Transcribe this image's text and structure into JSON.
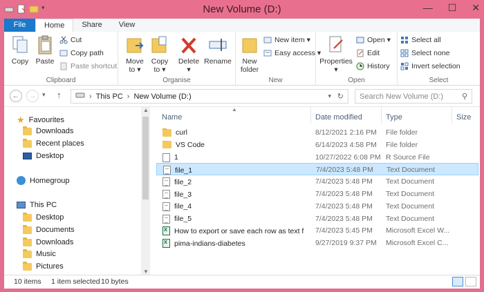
{
  "window": {
    "title": "New Volume (D:)",
    "minimize": "—",
    "maximize": "☐",
    "close": "✕"
  },
  "tabs": [
    {
      "label": "File"
    },
    {
      "label": "Home"
    },
    {
      "label": "Share"
    },
    {
      "label": "View"
    }
  ],
  "ribbon": {
    "clipboard": {
      "label": "Clipboard",
      "copy": "Copy",
      "paste": "Paste",
      "cut": "Cut",
      "copy_path": "Copy path",
      "paste_shortcut": "Paste shortcut"
    },
    "organise": {
      "label": "Organise",
      "move_to": "Move",
      "move_to2": "to ▾",
      "copy_to": "Copy",
      "copy_to2": "to ▾",
      "delete": "Delete",
      "delete2": "▾",
      "rename": "Rename"
    },
    "new": {
      "label": "New",
      "new_folder": "New",
      "new_folder2": "folder",
      "new_item": "New item ▾",
      "easy_access": "Easy access ▾"
    },
    "open": {
      "label": "Open",
      "properties": "Properties",
      "properties2": "▾",
      "open": "Open ▾",
      "edit": "Edit",
      "history": "History"
    },
    "select": {
      "label": "Select",
      "select_all": "Select all",
      "select_none": "Select none",
      "invert": "Invert selection"
    }
  },
  "address": {
    "path": [
      "This PC",
      "New Volume (D:)"
    ],
    "search_placeholder": "Search New Volume (D:)"
  },
  "nav": {
    "favourites": "Favourites",
    "favourites_items": [
      "Downloads",
      "Recent places",
      "Desktop"
    ],
    "homegroup": "Homegroup",
    "this_pc": "This PC",
    "this_pc_items": [
      "Desktop",
      "Documents",
      "Downloads",
      "Music",
      "Pictures"
    ]
  },
  "columns": {
    "name": "Name",
    "date": "Date modified",
    "type": "Type",
    "size": "Size"
  },
  "files": [
    {
      "name": "curl",
      "date": "8/12/2021 2:16 PM",
      "type": "File folder",
      "icon": "folder"
    },
    {
      "name": "VS Code",
      "date": "6/14/2023 4:58 PM",
      "type": "File folder",
      "icon": "folder"
    },
    {
      "name": "1",
      "date": "10/27/2022 6:08 PM",
      "type": "R Source File",
      "icon": "file"
    },
    {
      "name": "file_1",
      "date": "7/4/2023 5:48 PM",
      "type": "Text Document",
      "icon": "txt",
      "selected": true
    },
    {
      "name": "file_2",
      "date": "7/4/2023 5:48 PM",
      "type": "Text Document",
      "icon": "txt"
    },
    {
      "name": "file_3",
      "date": "7/4/2023 5:48 PM",
      "type": "Text Document",
      "icon": "txt"
    },
    {
      "name": "file_4",
      "date": "7/4/2023 5:48 PM",
      "type": "Text Document",
      "icon": "txt"
    },
    {
      "name": "file_5",
      "date": "7/4/2023 5:48 PM",
      "type": "Text Document",
      "icon": "txt"
    },
    {
      "name": "How to export or save each row as text fil...",
      "date": "7/4/2023 5:45 PM",
      "type": "Microsoft Excel W...",
      "icon": "excel"
    },
    {
      "name": "pima-indians-diabetes",
      "date": "9/27/2019 9:37 PM",
      "type": "Microsoft Excel C...",
      "icon": "excel"
    }
  ],
  "status": {
    "count": "10 items",
    "selected": "1 item selected",
    "size": "10 bytes"
  },
  "colors": {
    "titlebar": "#e8708e",
    "file_tab": "#1979ca",
    "selection": "#cce8ff",
    "folder": "#f4c95d"
  }
}
